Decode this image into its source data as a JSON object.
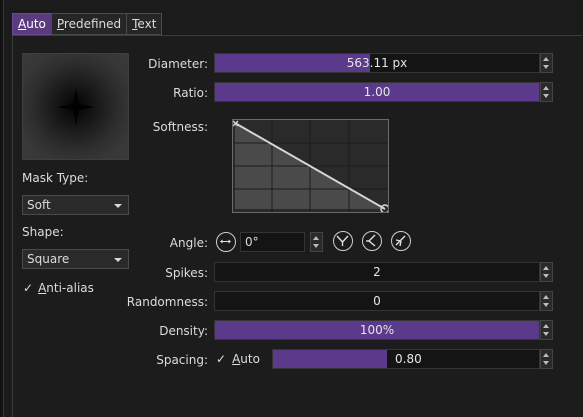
{
  "tabs": [
    {
      "key": "A",
      "rest": "uto",
      "label": "Auto"
    },
    {
      "key": "P",
      "rest": "redefined",
      "label": "Predefined"
    },
    {
      "key": "T",
      "rest": "ext",
      "label": "Text"
    }
  ],
  "mask_type": {
    "label": "Mask Type:",
    "value": "Soft"
  },
  "shape": {
    "label": "Shape:",
    "value": "Square"
  },
  "anti_alias": {
    "checked": true,
    "key": "A",
    "rest": "nti-alias",
    "label": "Anti-alias"
  },
  "diameter": {
    "label": "Diameter:",
    "value": "563.11 px",
    "fill": 0.55
  },
  "ratio": {
    "label": "Ratio:",
    "value": "1.00",
    "fill": 1.0
  },
  "softness": {
    "label": "Softness:"
  },
  "angle": {
    "label": "Angle:",
    "value": "0°"
  },
  "spikes": {
    "label": "Spikes:",
    "value": "2",
    "fill": 0.0
  },
  "randomness": {
    "label": "Randomness:",
    "value": "0",
    "fill": 0.0
  },
  "density": {
    "label": "Density:",
    "value": "100%",
    "fill": 1.0
  },
  "spacing": {
    "label": "Spacing:",
    "auto_checked": true,
    "auto_key": "A",
    "auto_rest": "uto",
    "auto_label": "Auto",
    "value": "0.80",
    "fill": 0.42
  },
  "colors": {
    "accent": "#5b3a8c",
    "tab_active": "#5a3b7e",
    "background": "#1b1b1b"
  }
}
